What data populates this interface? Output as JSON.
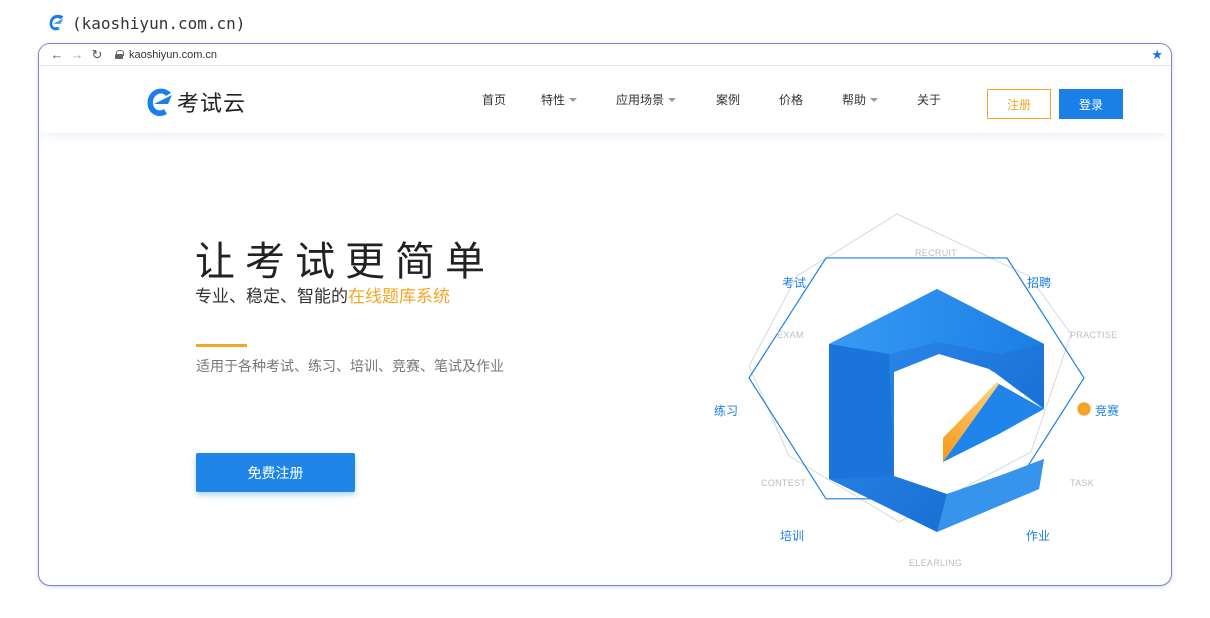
{
  "caption": {
    "text": "(kaoshiyun.com.cn)"
  },
  "browser": {
    "url": "kaoshiyun.com.cn",
    "back_icon": "arrow-left-icon",
    "forward_icon": "arrow-right-icon",
    "reload_icon": "reload-icon",
    "bookmark_icon": "star-icon"
  },
  "header": {
    "brand_name": "考试云",
    "nav": [
      {
        "label": "首页",
        "has_dropdown": false
      },
      {
        "label": "特性",
        "has_dropdown": true
      },
      {
        "label": "应用场景",
        "has_dropdown": true
      },
      {
        "label": "案例",
        "has_dropdown": false
      },
      {
        "label": "价格",
        "has_dropdown": false
      },
      {
        "label": "帮助",
        "has_dropdown": true
      },
      {
        "label": "关于",
        "has_dropdown": false
      }
    ],
    "register_label": "注册",
    "login_label": "登录"
  },
  "hero": {
    "title": "让考试更简单",
    "subtitle_plain": "专业、稳定、智能的",
    "subtitle_highlight": "在线题库系统",
    "description": "适用于各种考试、练习、培训、竞赛、笔试及作业",
    "cta_label": "免费注册"
  },
  "diagram": {
    "cn_labels": {
      "exam": "考试",
      "recruit": "招聘",
      "practice": "练习",
      "contest": "竞赛",
      "elearning": "培训",
      "task": "作业"
    },
    "en_labels": {
      "recruit": "RECRUIT",
      "exam": "EXAM",
      "practise": "PRACTISE",
      "contest": "CONTEST",
      "task": "TASK",
      "elearning": "ELEARLING"
    },
    "active_item": "竞赛"
  },
  "colors": {
    "brand_blue": "#1a7fe6",
    "accent_orange": "#f5a623",
    "frame_border": "#7a86c6"
  }
}
